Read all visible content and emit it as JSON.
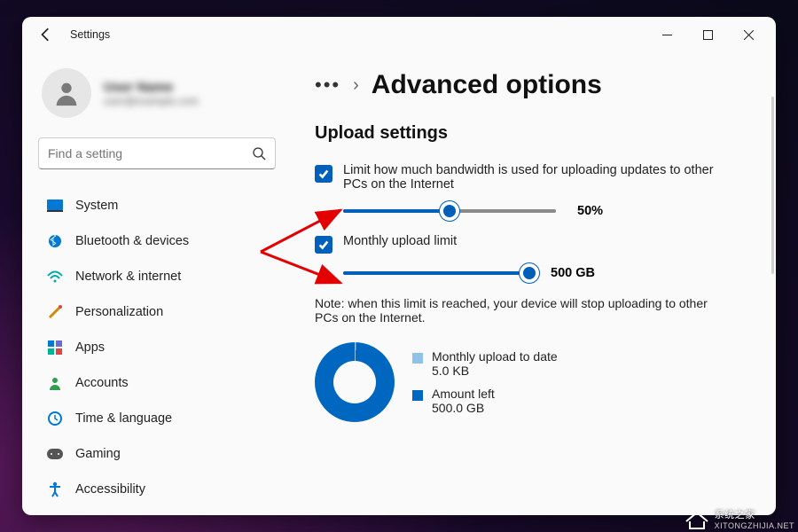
{
  "window": {
    "title": "Settings"
  },
  "profile": {
    "name": "User Name",
    "sub": "user@example.com"
  },
  "search": {
    "placeholder": "Find a setting"
  },
  "nav": [
    {
      "icon": "system",
      "label": "System"
    },
    {
      "icon": "bluetooth",
      "label": "Bluetooth & devices"
    },
    {
      "icon": "network",
      "label": "Network & internet"
    },
    {
      "icon": "personalization",
      "label": "Personalization"
    },
    {
      "icon": "apps",
      "label": "Apps"
    },
    {
      "icon": "accounts",
      "label": "Accounts"
    },
    {
      "icon": "time",
      "label": "Time & language"
    },
    {
      "icon": "gaming",
      "label": "Gaming"
    },
    {
      "icon": "accessibility",
      "label": "Accessibility"
    }
  ],
  "breadcrumb": {
    "title": "Advanced options"
  },
  "upload": {
    "section_title": "Upload settings",
    "bandwidth": {
      "label": "Limit how much bandwidth is used for uploading updates to other PCs on the Internet",
      "checked": true,
      "percent": 50,
      "percent_display": "50%"
    },
    "monthly": {
      "label": "Monthly upload limit",
      "checked": true,
      "percent": 100,
      "value_display": "500 GB"
    },
    "note": "Note: when this limit is reached, your device will stop uploading to other PCs on the Internet.",
    "chart": {
      "uploaded": {
        "label": "Monthly upload to date",
        "value": "5.0 KB",
        "color": "#90c2e7"
      },
      "left": {
        "label": "Amount left",
        "value": "500.0 GB",
        "color": "#0067c0"
      }
    }
  },
  "watermark": {
    "main": "系统之家",
    "sub": "XITONGZHIJIA.NET"
  },
  "colors": {
    "accent": "#005fb8"
  }
}
